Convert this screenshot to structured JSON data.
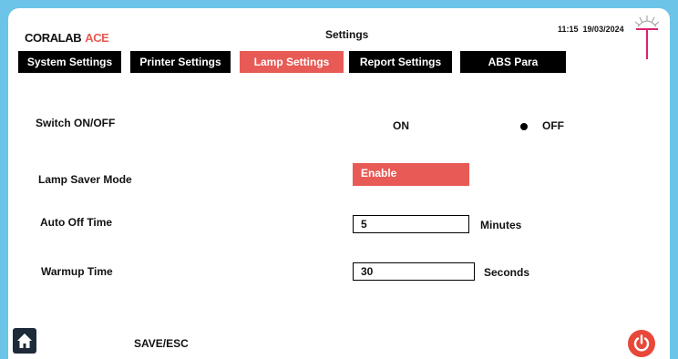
{
  "header": {
    "logo_main": "CORALAB",
    "logo_accent": "ACE",
    "title": "Settings",
    "time": "11:15",
    "date": "19/03/2024"
  },
  "tabs": [
    {
      "label": "System Settings",
      "active": false
    },
    {
      "label": "Printer Settings",
      "active": false
    },
    {
      "label": "Lamp Settings",
      "active": true
    },
    {
      "label": "Report Settings",
      "active": false
    },
    {
      "label": "ABS Para",
      "active": false
    }
  ],
  "switch": {
    "label": "Switch ON/OFF",
    "on_label": "ON",
    "off_label": "OFF",
    "selected": "OFF"
  },
  "lamp_saver": {
    "label": "Lamp Saver Mode",
    "button_label": "Enable"
  },
  "auto_off": {
    "label": "Auto Off Time",
    "value": "5",
    "unit": "Minutes"
  },
  "warmup": {
    "label": "Warmup Time",
    "value": "30",
    "unit": "Seconds"
  },
  "footer": {
    "save_label": "SAVE/ESC"
  },
  "colors": {
    "accent": "#e85a55",
    "tab_bg": "#000000",
    "frame_bg": "#6cc4e8",
    "brand": "#d6246e",
    "power": "#e8483a",
    "home_bg": "#1d2a39"
  },
  "icons": {
    "home": "home-icon",
    "power": "power-icon",
    "brand": "brand-logo-icon"
  }
}
